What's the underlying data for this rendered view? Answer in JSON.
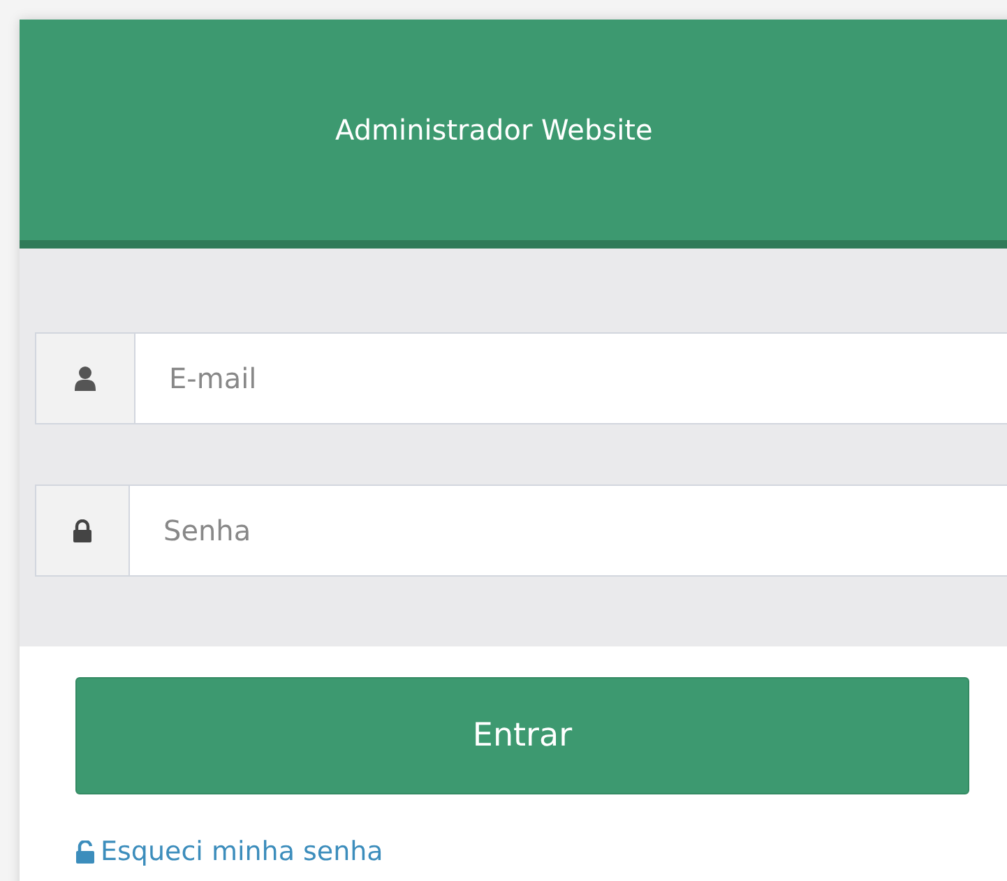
{
  "header": {
    "title": "Administrador Website"
  },
  "fields": [
    {
      "kind": "user",
      "placeholder": "E-mail"
    },
    {
      "kind": "lock",
      "placeholder": "Senha"
    }
  ],
  "submit": {
    "label": "Entrar"
  },
  "forgot_link": {
    "label": "Esqueci minha senha"
  }
}
